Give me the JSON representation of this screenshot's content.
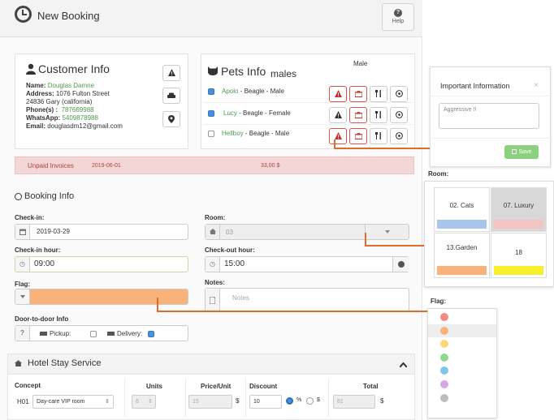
{
  "header": {
    "title": "New Booking",
    "help_label": "Help",
    "help_glyph": "?"
  },
  "customer": {
    "heading": "Customer Info",
    "name_label": "Name:",
    "name": "Douglas Damne",
    "address_label": "Address:",
    "address_line1": "1076 Fulton Street",
    "address_line2": "24836 Gary (california)",
    "phone_label": "Phone(s) :",
    "phone": "787669988",
    "whatsapp_label": "WhatsApp:",
    "whatsapp": "5409878988",
    "email_label": "Email:",
    "email": "douglasdm12@gmail.com"
  },
  "pets": {
    "heading": "Pets Info",
    "ghost_female": "males",
    "ghost_male": "Male",
    "items": [
      {
        "name": "Apolo",
        "details": " - Beagle - Male",
        "checked": true
      },
      {
        "name": "Lucy",
        "details": " - Beagle - Female",
        "checked": true
      },
      {
        "name": "Hellboy",
        "details": " - Beagle - Male",
        "checked": false
      }
    ]
  },
  "unpaid": {
    "label": "Unpaid Invoices",
    "date": "2019-06-01",
    "amount": "33,00 $"
  },
  "booking": {
    "heading": "Booking Info",
    "checkin_label": "Check-in:",
    "checkin_value": "2019-03-29",
    "checkin_hour_label": "Check-in hour:",
    "checkin_hour_value": "09:00",
    "room_label": "Room:",
    "room_value": "03",
    "checkout_hour_label": "Check-out hour:",
    "checkout_hour_value": "15:00",
    "flag_label": "Flag:",
    "flag_color": "#f9b27a",
    "notes_label": "Notes:",
    "notes_placeholder": "Notes",
    "door_label": "Door-to-door Info",
    "door_glyph": "?",
    "pickup_label": "Pickup:",
    "delivery_label": "Delivery:"
  },
  "hotel": {
    "heading": "Hotel Stay Service",
    "columns": [
      "Concept",
      "Units",
      "Price/Unit",
      "Discount",
      "Total"
    ],
    "row": {
      "code": "H01",
      "concept": "Day-care VIP room",
      "units": "6",
      "price": "15",
      "currency": "$",
      "discount": "10",
      "pct": "%",
      "dollar": "$",
      "total": "81",
      "total_currency": "$"
    }
  },
  "important": {
    "title": "Important Information",
    "close": "×",
    "text": "Aggressive !!",
    "save_label": "Save"
  },
  "room_picker": {
    "label": "Room:",
    "rooms": [
      {
        "name": "02. Cats",
        "color": "#a9c6ea"
      },
      {
        "name": "07. Luxury",
        "color": "#f3c4c4"
      },
      {
        "name": "13.Garden",
        "color": "#f9b27a"
      },
      {
        "name": "18",
        "color": "#f7ef2c"
      }
    ]
  },
  "flag_picker": {
    "label": "Flag:",
    "colors": [
      "#f28b82",
      "#f9b27a",
      "#fbd67a",
      "#8fd88f",
      "#7cc8ec",
      "#d7a7e8",
      "#bdbdbd"
    ]
  }
}
